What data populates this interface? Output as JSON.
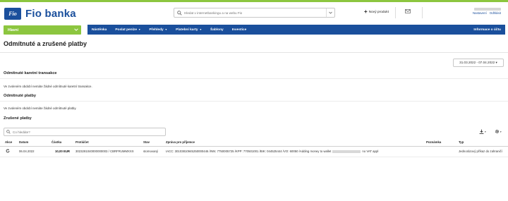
{
  "brand": {
    "badge": "Fio",
    "name": "Fio banka"
  },
  "header": {
    "search_placeholder": "Hledat v internetbankingu a na webu Fio",
    "new_product": "Nový produkt",
    "logout": "Odhlásit",
    "settings": "Nastavení"
  },
  "nav": {
    "main_select": "Hlavní",
    "items": [
      {
        "label": "Nástěnka",
        "caret": false
      },
      {
        "label": "Poslat peníze",
        "caret": true
      },
      {
        "label": "Přehledy",
        "caret": true
      },
      {
        "label": "Platební karty",
        "caret": true
      },
      {
        "label": "Šablony",
        "caret": false
      },
      {
        "label": "Investice",
        "caret": false
      }
    ],
    "account_info": "Informace o účtu"
  },
  "page": {
    "title": "Odmítnuté a zrušené platby",
    "date_range": "31.03.2022 - 07.04.2022 ▾"
  },
  "sections": {
    "card": {
      "title": "Odmítnuté karetní transakce",
      "empty": "Ve zvoleném období nemáte žádné odmítnuté karetní transakce."
    },
    "rejected": {
      "title": "Odmítnuté platby",
      "empty": "Ve zvoleném období nemáte žádné odmítnuté platby."
    },
    "cancelled": {
      "title": "Zrušené platby"
    }
  },
  "filter": {
    "placeholder": "Co hledáte?"
  },
  "table": {
    "headers": {
      "action": "Akce",
      "date": "Datum",
      "amount": "Částka",
      "counter": "Protiúčet",
      "state": "Stav",
      "message": "Zpráva pro příjemce",
      "note": "Poznámka",
      "type": "Typ"
    },
    "rows": [
      {
        "date": "06.04.2022",
        "amount": "10,00 EUR",
        "counter": "3023281040000000003 / CBRFRUMMXXX",
        "state": "stornovaný",
        "message_a": "IACC: 30103810945250000446 /INN: 7750005725 /KPP: 770501001 /BIK: 044525444 /VO: 60050 /Adding money to wallet",
        "message_b": "no VAT appl",
        "note": "",
        "type": "Jednorázový příkaz do zahraničí"
      }
    ]
  },
  "colors": {
    "brand_blue": "#1a4f9c",
    "brand_green": "#8cc63f"
  }
}
